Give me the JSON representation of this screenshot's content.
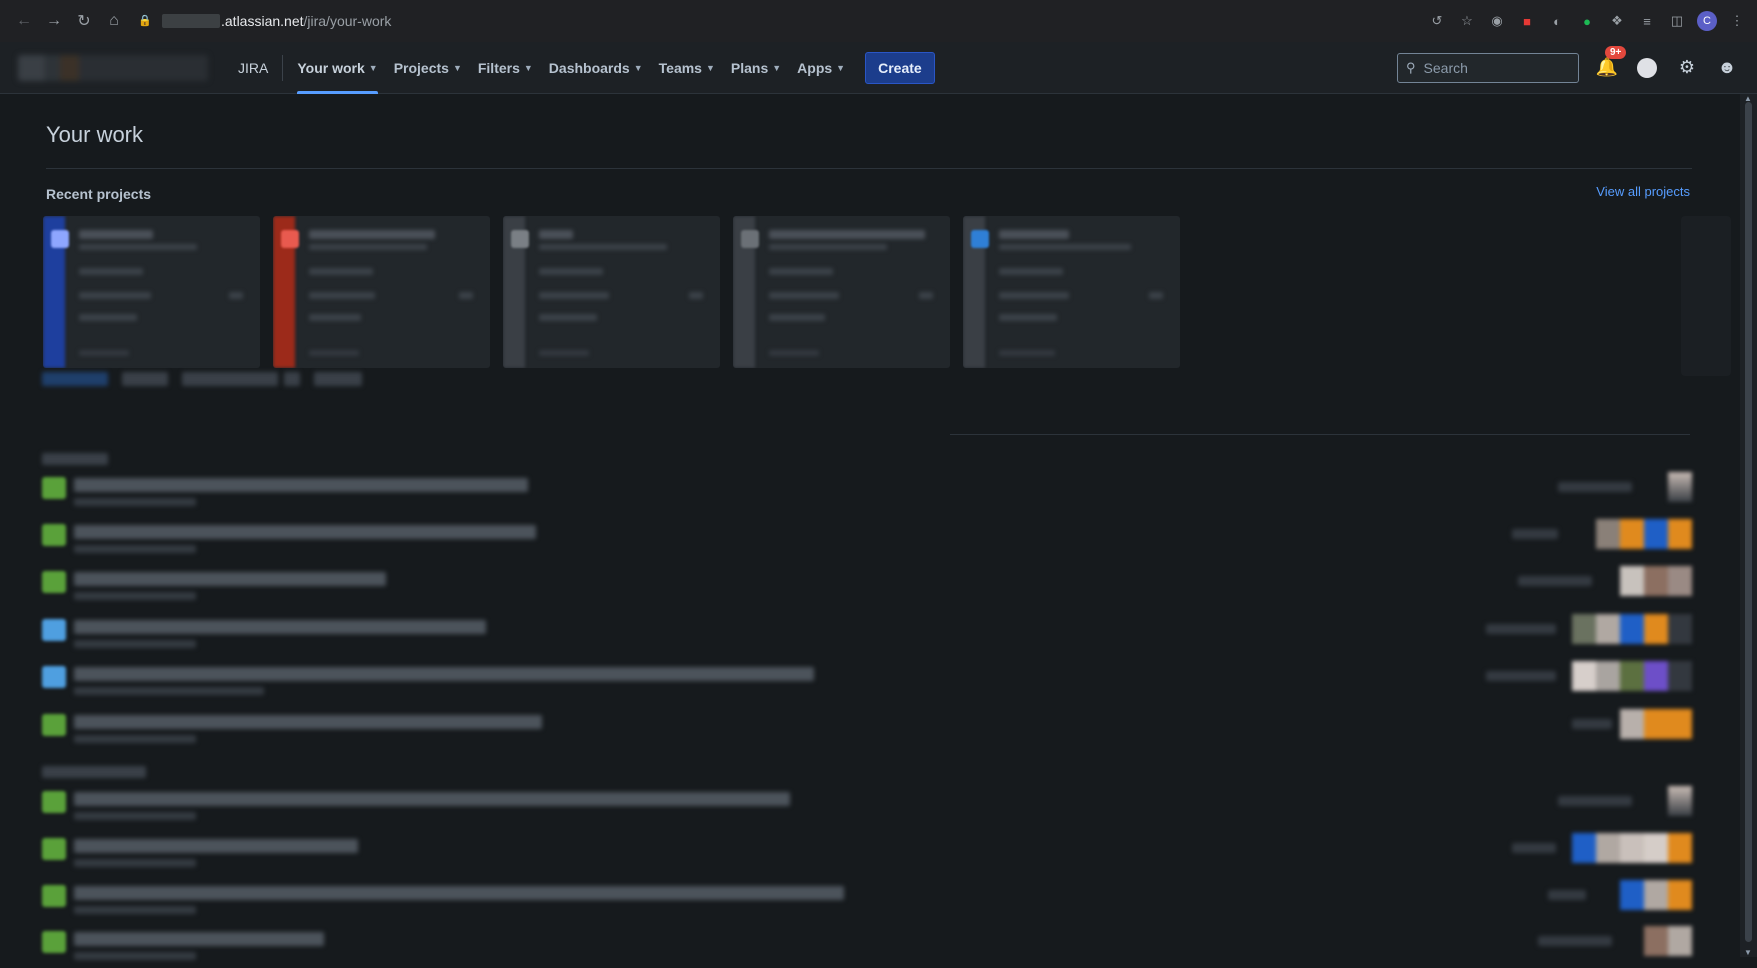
{
  "browser": {
    "url_domain": ".atlassian.net",
    "url_path": "/jira/your-work",
    "profile_initial": "C"
  },
  "topnav": {
    "product": "JIRA",
    "items": [
      {
        "label": "Your work",
        "active": true
      },
      {
        "label": "Projects"
      },
      {
        "label": "Filters"
      },
      {
        "label": "Dashboards"
      },
      {
        "label": "Teams"
      },
      {
        "label": "Plans"
      },
      {
        "label": "Apps"
      }
    ],
    "create_label": "Create",
    "search_placeholder": "Search",
    "notifications_badge": "9+"
  },
  "page": {
    "title": "Your work",
    "recent_projects_title": "Recent projects",
    "view_all_label": "View all projects"
  },
  "colors": {
    "accent": "#579dff",
    "create_bg": "#1c3d8c",
    "project_stripes": [
      "#1e3f9e",
      "#9c2a1a",
      "#3a3f45",
      "#3a3f45",
      "#3a3f45"
    ],
    "project_icons": [
      "#8ea6ff",
      "#e85a4f",
      "#7a7f85",
      "#6b7076",
      "#2f7fd6"
    ],
    "story_icon": "#5aa13a",
    "task_icon": "#4f9fe0"
  },
  "icons": {
    "back": "arrow-left-icon",
    "forward": "arrow-right-icon",
    "reload": "reload-icon",
    "home": "home-icon",
    "lock": "lock-icon",
    "share": "share-icon",
    "star": "star-icon",
    "search": "search-icon",
    "notifications": "bell-icon",
    "help": "help-icon",
    "settings": "gear-icon",
    "profile": "avatar-icon"
  }
}
